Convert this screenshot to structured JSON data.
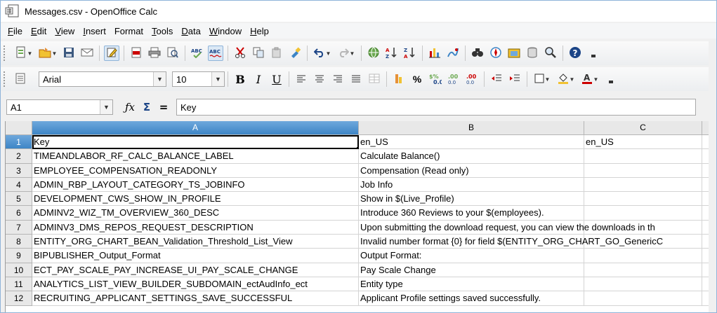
{
  "window": {
    "title": "Messages.csv - OpenOffice Calc"
  },
  "menu": [
    {
      "ul": "F",
      "rest": "ile"
    },
    {
      "ul": "E",
      "rest": "dit"
    },
    {
      "ul": "V",
      "rest": "iew"
    },
    {
      "ul": "I",
      "rest": "nsert"
    },
    {
      "ul": "",
      "rest": "Format"
    },
    {
      "ul": "T",
      "rest": "ools"
    },
    {
      "ul": "D",
      "rest": "ata"
    },
    {
      "ul": "W",
      "rest": "indow"
    },
    {
      "ul": "H",
      "rest": "elp"
    }
  ],
  "formatting": {
    "font_name": "Arial",
    "font_size": "10",
    "bold_label": "B",
    "italic_label": "I",
    "underline_label": "U",
    "percent_label": "%"
  },
  "formula_bar": {
    "cell_reference": "A1",
    "formula_value": "Key",
    "sum_label": "Σ",
    "equals_label": "="
  },
  "sheet": {
    "columns": [
      "A",
      "B",
      "C"
    ],
    "rows": [
      {
        "num": "1",
        "a": "Key",
        "b": "en_US",
        "c": "en_US"
      },
      {
        "num": "2",
        "a": "TIMEANDLABOR_RF_CALC_BALANCE_LABEL",
        "b": "Calculate Balance()",
        "c": ""
      },
      {
        "num": "3",
        "a": "EMPLOYEE_COMPENSATION_READONLY",
        "b": "Compensation (Read only)",
        "c": ""
      },
      {
        "num": "4",
        "a": "ADMIN_RBP_LAYOUT_CATEGORY_TS_JOBINFO",
        "b": "Job Info",
        "c": ""
      },
      {
        "num": "5",
        "a": "DEVELOPMENT_CWS_SHOW_IN_PROFILE",
        "b": "Show in $(Live_Profile)",
        "c": ""
      },
      {
        "num": "6",
        "a": "ADMINV2_WIZ_TM_OVERVIEW_360_DESC",
        "b": "Introduce 360 Reviews to your $(employees).",
        "c": ""
      },
      {
        "num": "7",
        "a": "ADMINV3_DMS_REPOS_REQUEST_DESCRIPTION",
        "b": "Upon submitting the download request, you can view the downloads in th",
        "c": ""
      },
      {
        "num": "8",
        "a": "ENTITY_ORG_CHART_BEAN_Validation_Threshold_List_View",
        "b": "Invalid number format {0} for field $(ENTITY_ORG_CHART_GO_GenericC",
        "c": ""
      },
      {
        "num": "9",
        "a": "BIPUBLISHER_Output_Format",
        "b": "Output Format:",
        "c": ""
      },
      {
        "num": "10",
        "a": "ECT_PAY_SCALE_PAY_INCREASE_UI_PAY_SCALE_CHANGE",
        "b": "Pay Scale Change",
        "c": ""
      },
      {
        "num": "11",
        "a": "ANALYTICS_LIST_VIEW_BUILDER_SUBDOMAIN_ectAudInfo_ect",
        "b": "Entity type",
        "c": ""
      },
      {
        "num": "12",
        "a": "RECRUITING_APPLICANT_SETTINGS_SAVE_SUCCESSFUL",
        "b": "Applicant Profile settings saved successfully.",
        "c": ""
      }
    ]
  },
  "icons": {
    "app": "calc-document-icon",
    "new": "new-document-icon",
    "open": "open-folder-icon",
    "save": "save-icon",
    "email": "email-icon",
    "edit_file": "edit-file-icon",
    "export_pdf": "pdf-icon",
    "print": "print-icon",
    "preview": "page-preview-icon",
    "spellcheck": "spellcheck-icon",
    "autospell": "autospellcheck-icon",
    "cut": "cut-icon",
    "copy": "copy-icon",
    "paste": "paste-icon",
    "clone": "clone-formatting-icon",
    "undo": "undo-icon",
    "redo": "redo-icon",
    "hyperlink": "hyperlink-icon",
    "sort_asc": "sort-ascending-icon",
    "sort_desc": "sort-descending-icon",
    "chart": "chart-icon",
    "draw": "show-draw-functions-icon",
    "find": "find-icon",
    "navigator": "navigator-icon",
    "gallery": "gallery-icon",
    "datasources": "data-sources-icon",
    "zoom": "zoom-icon",
    "help": "help-icon"
  },
  "colors": {
    "header_active": "#3d85c6",
    "grid_line": "#d4d4d4",
    "window_border": "#8fb4d9"
  }
}
